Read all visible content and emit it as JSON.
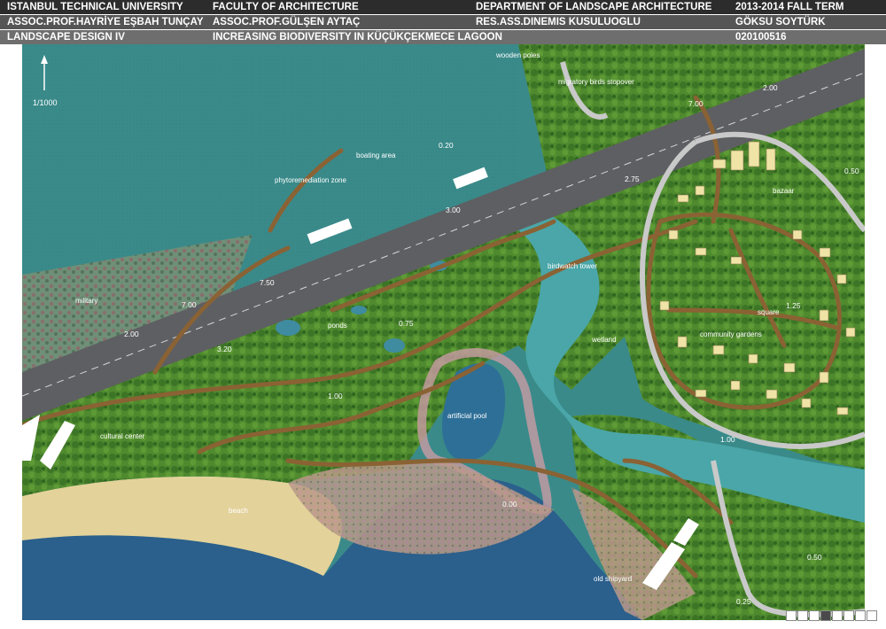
{
  "header": {
    "university": "ISTANBUL TECHNICAL UNIVERSITY",
    "faculty": "FACULTY OF ARCHITECTURE",
    "department": "DEPARTMENT OF LANDSCAPE ARCHITECTURE",
    "term": "2013-2014 FALL TERM",
    "instructor1": "ASSOC.PROF.HAYRİYE EŞBAH TUNÇAY",
    "instructor2": "ASSOC.PROF.GÜLŞEN AYTAÇ",
    "assistant": "RES.ASS.DINEMIS KUSULUOGLU",
    "student": "GÖKSU SOYTÜRK",
    "course": "LANDSCAPE DESIGN IV",
    "project_title": "INCREASING BIODIVERSITY IN KÜÇÜKÇEKMECE LAGOON",
    "student_no": "020100516"
  },
  "map": {
    "scale": "1/1000",
    "labels": {
      "wooden_poles": "wooden poles",
      "migratory": "migratory birds stopover",
      "boating": "boating area",
      "phyto": "phytoremediation zone",
      "military": "military",
      "ponds": "ponds",
      "birdwatch": "birdwatch tower",
      "wetland": "wetland",
      "artificial_pool": "artificial pool",
      "cultural_center": "cultural center",
      "beach": "beach",
      "bazaar": "bazaar",
      "square": "square",
      "community_gardens": "community gardens",
      "old_shipyard": "old shipyard"
    },
    "elevations": {
      "e_2_00_top": "2.00",
      "e_7_00_top": "7.00",
      "e_0_20": "0.20",
      "e_2_75": "2.75",
      "e_0_50_right": "0.50",
      "e_3_00": "3.00",
      "e_7_50": "7.50",
      "e_7_00_left": "7.00",
      "e_2_00_left": "2.00",
      "e_3_20": "3.20",
      "e_0_75": "0.75",
      "e_1_00_mid": "1.00",
      "e_1_25": "1.25",
      "e_1_00_right": "1.00",
      "e_0_00": "0.00",
      "e_0_50_bottom": "0.50",
      "e_0_25": "0.25"
    }
  },
  "pager": {
    "count": 8,
    "active": 3
  }
}
